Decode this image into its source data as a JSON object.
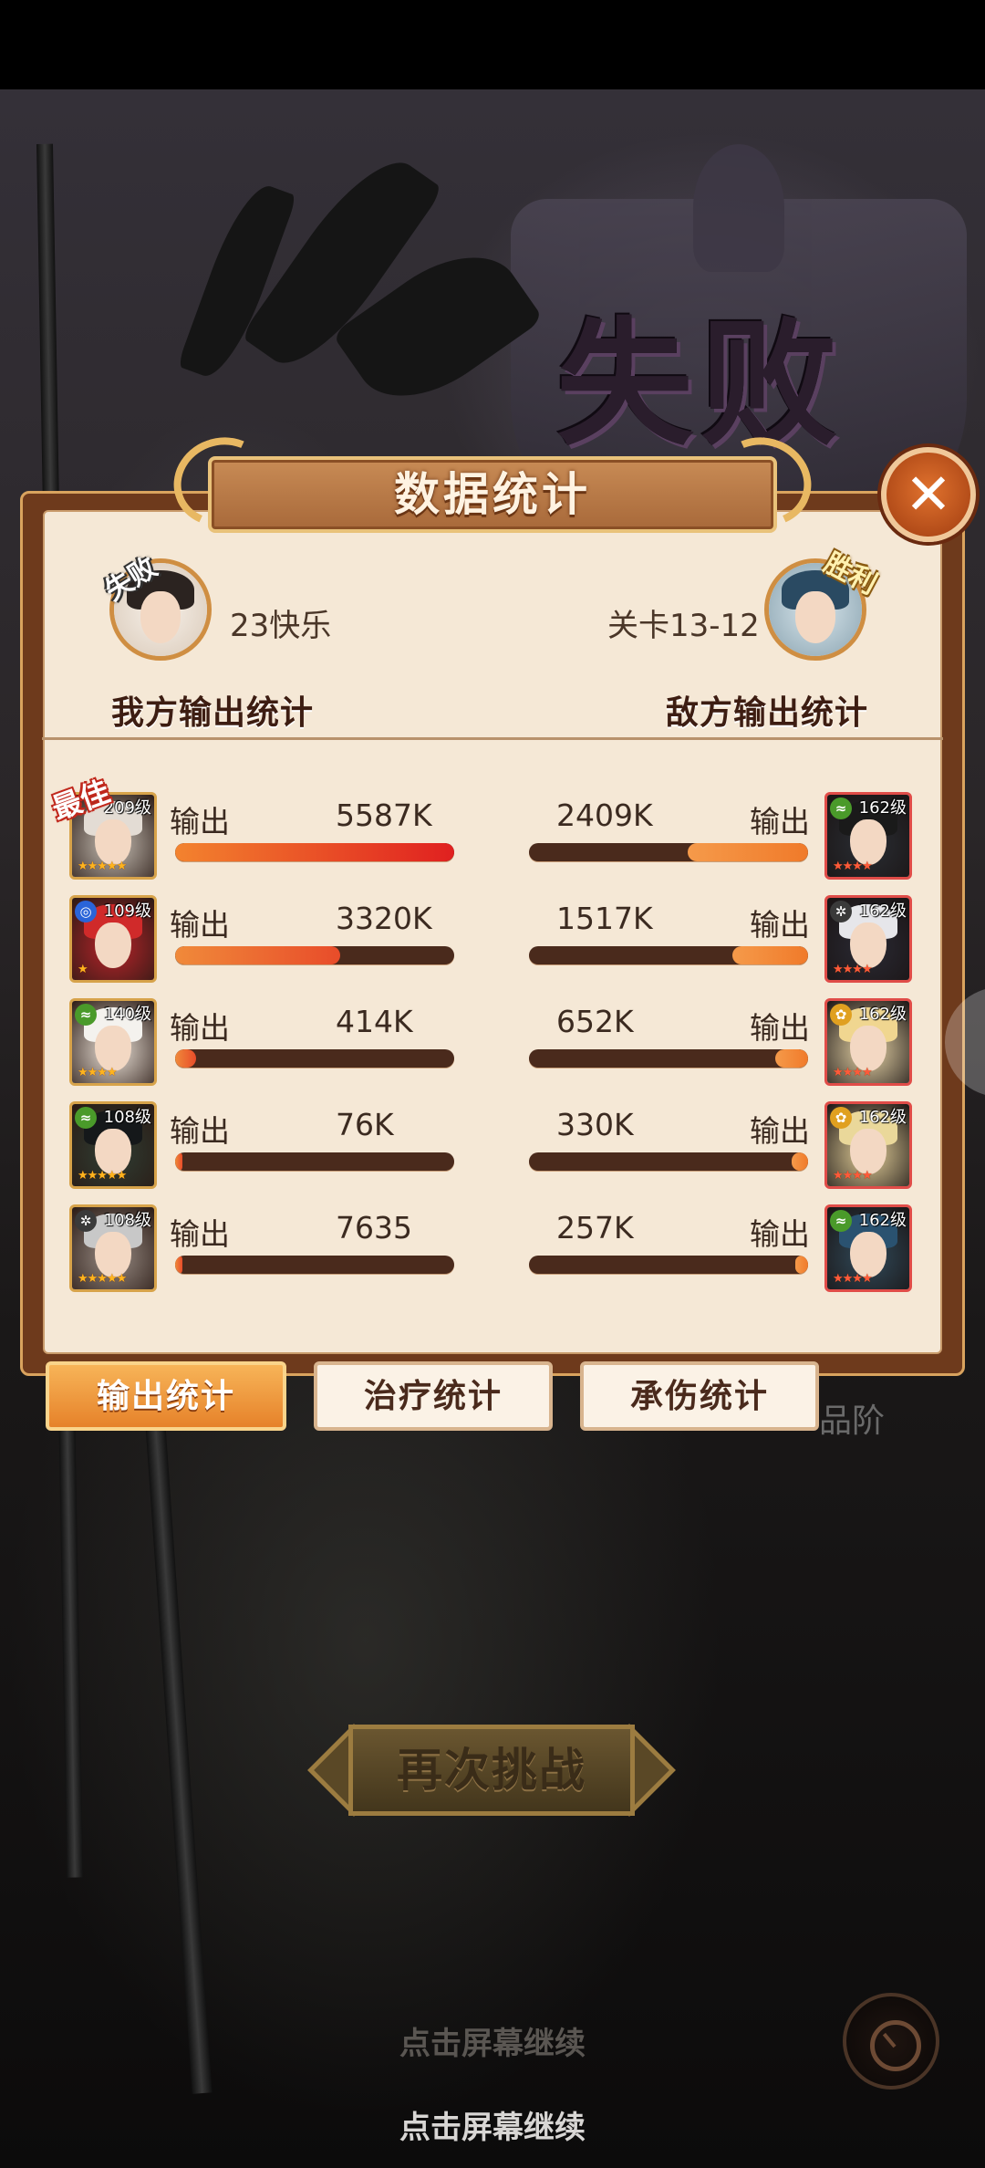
{
  "colors": {
    "panel_frame": "#6e3a1c",
    "panel_bg": "#f5e8d6",
    "bar_track": "#4a2a1c",
    "bar_fill": "#e84c2a",
    "tab_active": "#f0992f",
    "close_button": "#c85420"
  },
  "header": {
    "defeat_title": "失败"
  },
  "panel": {
    "title": "数据统计",
    "close_icon": "close-x-icon",
    "our_side": {
      "result_tag": "失败",
      "player_name": "23快乐",
      "label": "我方输出统计"
    },
    "enemy_side": {
      "result_tag": "胜利",
      "player_name": "关卡13-12",
      "label": "敌方输出统计"
    },
    "best_tag": "最佳",
    "output_label": "输出",
    "rows": [
      {
        "ally": {
          "level": "209级",
          "value": "5587K",
          "ratio": 1.0,
          "stars": "★★★★★"
        },
        "enemy": {
          "level": "162级",
          "value": "2409K",
          "ratio": 0.43,
          "stars": "★★★★"
        }
      },
      {
        "ally": {
          "level": "109级",
          "value": "3320K",
          "ratio": 0.59,
          "stars": "★"
        },
        "enemy": {
          "level": "162级",
          "value": "1517K",
          "ratio": 0.27,
          "stars": "★★★★"
        }
      },
      {
        "ally": {
          "level": "140级",
          "value": "414K",
          "ratio": 0.074,
          "stars": "★★★★"
        },
        "enemy": {
          "level": "162级",
          "value": "652K",
          "ratio": 0.117,
          "stars": "★★★★"
        }
      },
      {
        "ally": {
          "level": "108级",
          "value": "76K",
          "ratio": 0.014,
          "stars": "★★★★★"
        },
        "enemy": {
          "level": "162级",
          "value": "330K",
          "ratio": 0.059,
          "stars": "★★★★"
        }
      },
      {
        "ally": {
          "level": "108级",
          "value": "7635",
          "ratio": 0.0014,
          "stars": "★★★★★"
        },
        "enemy": {
          "level": "162级",
          "value": "257K",
          "ratio": 0.046,
          "stars": "★★★★"
        }
      }
    ]
  },
  "tabs": [
    {
      "label": "输出统计",
      "active": true
    },
    {
      "label": "治疗统计",
      "active": false
    },
    {
      "label": "承伤统计",
      "active": false
    }
  ],
  "quality_text": "品阶",
  "retry_button": "再次挑战",
  "continue_hint_dim": "点击屏幕继续",
  "continue_hint": "点击屏幕继续"
}
